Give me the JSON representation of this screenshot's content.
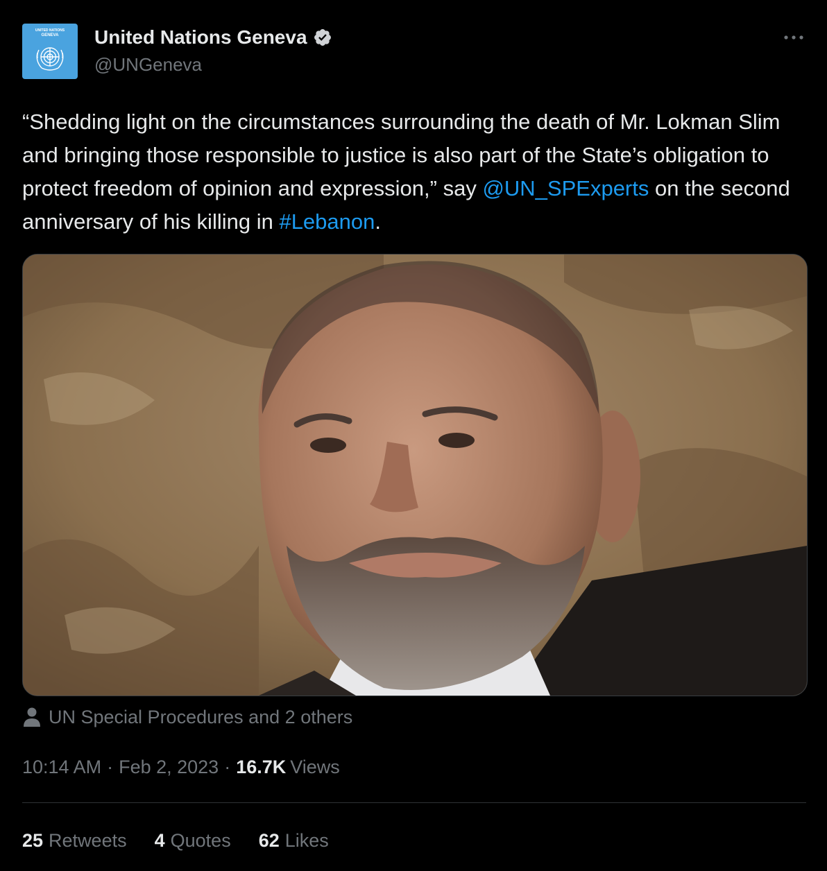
{
  "account": {
    "avatar_title": "UNITED NATIONS",
    "avatar_subtitle": "GENEVA",
    "display_name": "United Nations Geneva",
    "handle": "@UNGeneva",
    "verified_icon": "verified-badge-icon",
    "verified_color": "#1d9bf0"
  },
  "more_icon": "more-horizontal-icon",
  "tweet": {
    "text_part1": "“Shedding light on the circumstances surrounding the death of Mr. Lokman Slim and bringing those responsible to justice is also part of the State’s obligation to protect freedom of opinion and expression,” say ",
    "mention": "@UN_SPExperts",
    "text_part2": " on the second anniversary of his killing in ",
    "hashtag": "#Lebanon",
    "text_part3": "."
  },
  "media": {
    "tagged_icon": "person-icon",
    "tagged_text": "UN Special Procedures and 2 others"
  },
  "meta": {
    "time": "10:14 AM",
    "separator": "·",
    "date": "Feb 2, 2023",
    "views_count": "16.7K",
    "views_label": "Views"
  },
  "stats": [
    {
      "count": "25",
      "label": "Retweets"
    },
    {
      "count": "4",
      "label": "Quotes"
    },
    {
      "count": "62",
      "label": "Likes"
    }
  ],
  "colors": {
    "background": "#000000",
    "text_primary": "#e7e9ea",
    "text_secondary": "#71767b",
    "link": "#1d9bf0",
    "avatar_bg": "#4aa3df"
  }
}
